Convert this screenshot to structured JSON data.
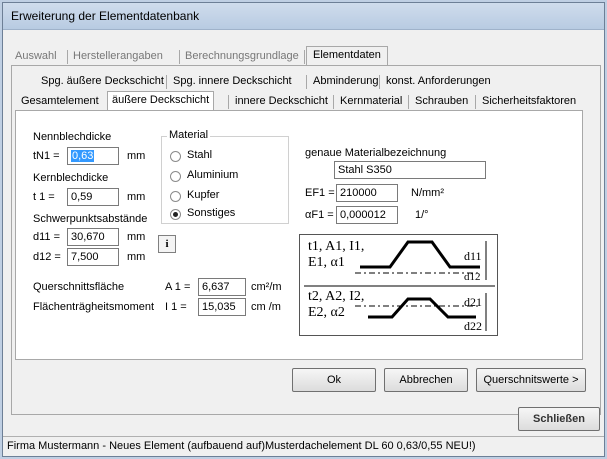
{
  "window": {
    "title": "Erweiterung der Elementdatenbank"
  },
  "tabs_main": [
    "Auswahl",
    "Herstellerangaben",
    "Berechnungsgrundlage",
    "Elementdaten"
  ],
  "tabs_row2": [
    "Spg. äußere Deckschicht",
    "Spg. innere Deckschicht",
    "Abminderung",
    "konst. Anforderungen"
  ],
  "tabs_row3": [
    "Gesamtelement",
    "äußere Deckschicht",
    "innere Deckschicht",
    "Kernmaterial",
    "Schrauben",
    "Sicherheitsfaktoren"
  ],
  "form": {
    "nennblechdicke_label": "Nennblechdicke",
    "tn1_label": "tN1 =",
    "tn1_value": "0,63",
    "mm": "mm",
    "kernblechdicke_label": "Kernblechdicke",
    "t1_label": "t 1 =",
    "t1_value": "0,59",
    "schwerpunkt_label": "Schwerpunktsabstände",
    "d11_label": "d11 =",
    "d11_value": "30,670",
    "d12_label": "d12 =",
    "d12_value": "7,500",
    "info_button": "i",
    "querschnitt_label": "Querschnittsfläche",
    "a1_label": "A 1 =",
    "a1_value": "6,637",
    "a1_unit": "cm²/m",
    "flaechen_label": "Flächenträgheitsmoment",
    "i1_label": "I 1 =",
    "i1_value": "15,035",
    "i1_unit": "cm  /m"
  },
  "material": {
    "group_label": "Material",
    "options": [
      "Stahl",
      "Aluminium",
      "Kupfer",
      "Sonstiges"
    ],
    "selected": "Sonstiges",
    "genaue_label": "genaue Materialbezeichnung",
    "genaue_value": "Stahl S350",
    "ef1_label": "EF1 =",
    "ef1_value": "210000",
    "ef1_unit": "N/mm²",
    "af1_label": "αF1 =",
    "af1_value": "0,000012",
    "af1_unit": "1/°"
  },
  "diagram": {
    "top_left_1": "t1, A1, I1,",
    "top_left_2": "E1, α1",
    "d11": "d11",
    "d12": "d12",
    "bot_left_1": "t2, A2, I2,",
    "bot_left_2": "E2, α2",
    "d21": "d21",
    "d22": "d22"
  },
  "buttons": {
    "ok": "Ok",
    "abbrechen": "Abbrechen",
    "querschnittswerte": "Querschnitswerte >",
    "schliessen": "Schließen"
  },
  "statusbar": {
    "text": "Firma Mustermann - Neues Element  (aufbauend auf)Musterdachelement DL 60 0,63/0,55 NEU!)"
  }
}
